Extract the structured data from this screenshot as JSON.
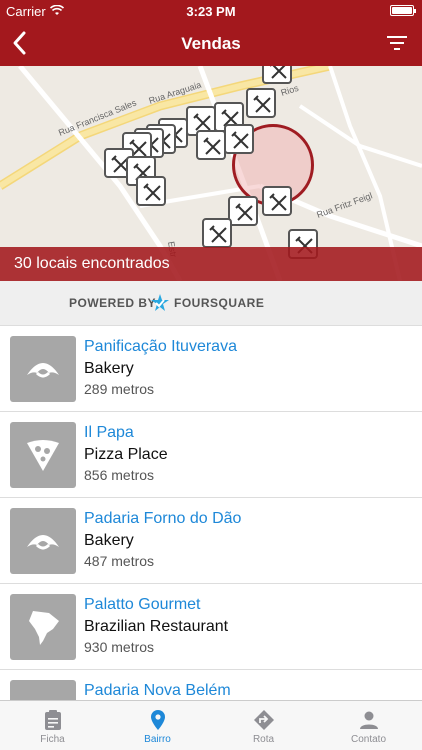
{
  "status": {
    "carrier": "Carrier",
    "time": "3:23 PM"
  },
  "nav": {
    "title": "Vendas",
    "back_icon": "chevron-left-icon",
    "filter_icon": "filter-icon"
  },
  "map": {
    "streets": [
      "Rua Francisca Sales",
      "Rua Araguaia",
      "Rios",
      "Rua Fritz Feigl",
      "Estr"
    ],
    "results_label": "30 locais encontrados"
  },
  "powered": {
    "prefix": "POWERED BY",
    "brand": "FOURSQUARE"
  },
  "places": [
    {
      "name": "Panificação Ituverava",
      "category": "Bakery",
      "distance": "289 metros",
      "icon": "croissant-icon"
    },
    {
      "name": "Il Papa",
      "category": "Pizza Place",
      "distance": "856 metros",
      "icon": "pizza-icon"
    },
    {
      "name": "Padaria Forno do Dão",
      "category": "Bakery",
      "distance": "487 metros",
      "icon": "croissant-icon"
    },
    {
      "name": "Palatto Gourmet",
      "category": "Brazilian Restaurant",
      "distance": "930 metros",
      "icon": "south-america-icon"
    },
    {
      "name": "Padaria Nova Belém",
      "category": "",
      "distance": "",
      "icon": "croissant-icon"
    }
  ],
  "tabs": [
    {
      "label": "Ficha",
      "icon": "clipboard-icon",
      "active": false
    },
    {
      "label": "Bairro",
      "icon": "map-pin-icon",
      "active": true
    },
    {
      "label": "Rota",
      "icon": "route-icon",
      "active": false
    },
    {
      "label": "Contato",
      "icon": "person-icon",
      "active": false
    }
  ],
  "colors": {
    "brand": "#a3181d",
    "link": "#1e88d8",
    "thumb": "#a7a7a7"
  }
}
